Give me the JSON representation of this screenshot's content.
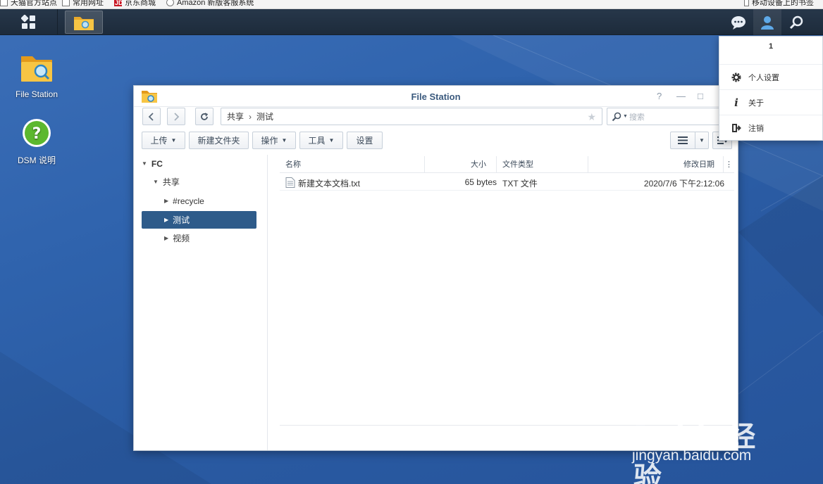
{
  "browser_bookmarks": [
    {
      "label": "天猫官方站点"
    },
    {
      "label": "常用网址"
    },
    {
      "label": "京东商城",
      "icon_text": "JD"
    },
    {
      "label": "Amazon 新版客服系统"
    }
  ],
  "browser_bookmark_right": "移动设备上的书签",
  "desktop": {
    "icons": [
      {
        "label": "File Station",
        "icon": "folder-search-icon"
      },
      {
        "label": "DSM 说明",
        "icon": "help-icon",
        "glyph": "?"
      }
    ]
  },
  "window": {
    "title": "File Station",
    "controls": {
      "help": "?",
      "minimize": "—",
      "maximize": "□"
    },
    "path": {
      "root": "共享",
      "separator": "›",
      "current": "测试"
    },
    "search_placeholder": "搜索",
    "toolbar": {
      "upload": "上传",
      "new_folder": "新建文件夹",
      "action": "操作",
      "tools": "工具",
      "settings": "设置"
    },
    "tree": {
      "root": "FC",
      "shared": "共享",
      "children": [
        "#recycle",
        "测试",
        "视频"
      ],
      "selected": "测试"
    },
    "columns": [
      "名称",
      "大小",
      "文件类型",
      "修改日期"
    ],
    "files": [
      {
        "name": "新建文本文档.txt",
        "size": "65 bytes",
        "type": "TXT 文件",
        "modified": "2020/7/6 下午2:12:06"
      }
    ]
  },
  "user_menu": {
    "username": "1",
    "items": [
      {
        "label": "个人设置",
        "icon": "gear-icon"
      },
      {
        "label": "关于",
        "icon": "info-icon"
      },
      {
        "label": "注销",
        "icon": "logout-icon"
      }
    ]
  },
  "watermark": {
    "main": "Baidu经验",
    "sub": "jingyan.baidu.com"
  }
}
